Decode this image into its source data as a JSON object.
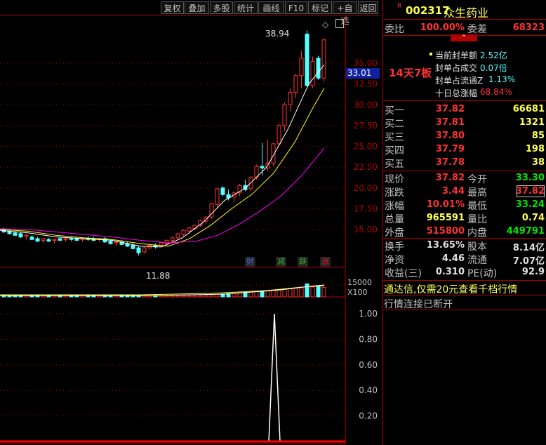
{
  "toolbar": [
    "复权",
    "叠加",
    "多股",
    "统计",
    "画线",
    "F10",
    "标记",
    "+自选",
    "返回"
  ],
  "price_axis": [
    "35.00",
    "32.50",
    "30.00",
    "27.50",
    "25.00",
    "22.50",
    "20.00",
    "17.50",
    "15.00"
  ],
  "current_price_tag": "33.01",
  "high_label": "38.94",
  "low_label": "11.88",
  "event_icons": [
    {
      "text": "财",
      "color": "#3b6fd6"
    },
    {
      "text": "减",
      "color": "#2fae2f"
    },
    {
      "text": "跌",
      "color": "#2fae2f"
    },
    {
      "text": "涨",
      "color": "#d62020"
    }
  ],
  "volume_axis": {
    "top": "15000",
    "unit": "X100"
  },
  "indicator_axis": [
    "1.00",
    "0.80",
    "0.60",
    "0.40",
    "0.20"
  ],
  "stock": {
    "r_mark": "R",
    "code": "002317",
    "name": "众生药业"
  },
  "weibi": {
    "label1": "委比",
    "value1": "100.00%",
    "label2": "委差",
    "value2": "68323"
  },
  "board_tag": "14天7板",
  "seal_info": [
    {
      "label": "当前封单额",
      "value": "2.52亿"
    },
    {
      "label": "封单占成交",
      "value": "0.07倍"
    },
    {
      "label": "封单占流通Z",
      "value": "1.13%"
    },
    {
      "label": "十日总涨幅",
      "value": "68.84%"
    }
  ],
  "bids": [
    {
      "label": "买一",
      "price": "37.82",
      "vol": "66681"
    },
    {
      "label": "买二",
      "price": "37.81",
      "vol": "1321"
    },
    {
      "label": "买三",
      "price": "37.80",
      "vol": "85"
    },
    {
      "label": "买四",
      "price": "37.79",
      "vol": "198"
    },
    {
      "label": "买五",
      "price": "37.78",
      "vol": "38"
    }
  ],
  "quote": [
    {
      "l1": "现价",
      "v1": "37.82",
      "l2": "今开",
      "v2": "33.30"
    },
    {
      "l1": "涨跌",
      "v1": "3.44",
      "l2": "最高",
      "v2": "37.82"
    },
    {
      "l1": "涨幅",
      "v1": "10.01%",
      "l2": "最低",
      "v2": "33.24"
    },
    {
      "l1": "总量",
      "v1": "965591",
      "l2": "量比",
      "v2": "0.74"
    },
    {
      "l1": "外盘",
      "v1": "515800",
      "l2": "内盘",
      "v2": "449791"
    }
  ],
  "fundamentals": [
    {
      "l1": "换手",
      "v1": "13.65%",
      "l2": "股本",
      "v2": "8.14亿"
    },
    {
      "l1": "净资",
      "v1": "4.46",
      "l2": "流通",
      "v2": "7.07亿"
    },
    {
      "l1": "收益(三)",
      "v1": "0.310",
      "l2": "PE(动)",
      "v2": "92.9"
    }
  ],
  "promo": "通达信,仅需20元查看千档行情",
  "status_msg": "行情连接已断开",
  "colors": {
    "up": "#ff3232",
    "down": "#54ffff",
    "yellow": "#ffff54",
    "green": "#00e600",
    "ma5": "#ffffff",
    "ma10": "#ffff00",
    "ma20": "#ff00ff",
    "grid": "#b00000"
  }
}
